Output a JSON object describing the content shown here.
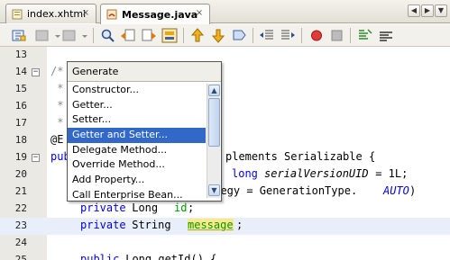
{
  "tabs": [
    {
      "label": "index.xhtml",
      "close": "×",
      "active": false
    },
    {
      "label": "Message.java",
      "close": "×",
      "active": true
    }
  ],
  "tab_nav": {
    "prev": "◀",
    "next": "▶",
    "list": "▼"
  },
  "editor": {
    "lines": [
      {
        "num": "13",
        "text": ""
      },
      {
        "num": "14",
        "fold": "−",
        "text": "/*"
      },
      {
        "num": "15",
        "text": " *"
      },
      {
        "num": "16",
        "text": " *"
      },
      {
        "num": "17",
        "text": " *"
      },
      {
        "num": "18",
        "text": "@E"
      },
      {
        "num": "19",
        "fold": "−",
        "kw": "pub",
        "text": "plements Serializable {"
      },
      {
        "num": "20",
        "kw_a": "long",
        "field": "serialVersionUID",
        "text_b": " = 1L;"
      },
      {
        "num": "21",
        "text": "ategy = GenerationType.",
        "enum": "AUTO",
        "text_b": ")"
      },
      {
        "num": "22",
        "kw_a": "private",
        "text": " Long ",
        "field_plain": "id",
        "text_b": ";"
      },
      {
        "num": "23",
        "kw_a": "private",
        "text": " String ",
        "msg": "message",
        "text_b": ";"
      },
      {
        "num": "24",
        "text": ""
      },
      {
        "num": "25",
        "kw_a": "public",
        "text": " Long getId() {"
      }
    ]
  },
  "popup": {
    "title": "Generate",
    "items": [
      "Constructor...",
      "Getter...",
      "Setter...",
      "Getter and Setter...",
      "Delegate Method...",
      "Override Method...",
      "Add Property...",
      "Call Enterprise Bean..."
    ],
    "selected_index": 3,
    "scroll_up": "▲",
    "scroll_down": "▼"
  },
  "colors": {
    "selection": "#3269c8",
    "keyword": "#0000e6",
    "field": "#009b00",
    "highlight_line": "#e9effa"
  }
}
